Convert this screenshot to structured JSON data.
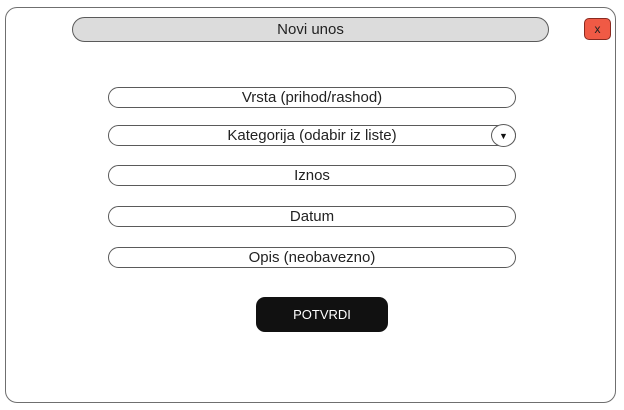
{
  "window": {
    "title": "Novi unos",
    "close_label": "x"
  },
  "form": {
    "type_field": "Vrsta (prihod/rashod)",
    "category_field": "Kategorija (odabir iz liste)",
    "amount_field": "Iznos",
    "date_field": "Datum",
    "description_field": "Opis (neobavezno)",
    "dropdown_icon": "▼",
    "confirm_label": "POTVRDI"
  },
  "colors": {
    "close_button": "#f05a45",
    "titlebar": "#dcdcdc",
    "confirm_button": "#111111"
  },
  "icons": {
    "dropdown": "chevron-down-icon",
    "close": "close-icon"
  }
}
